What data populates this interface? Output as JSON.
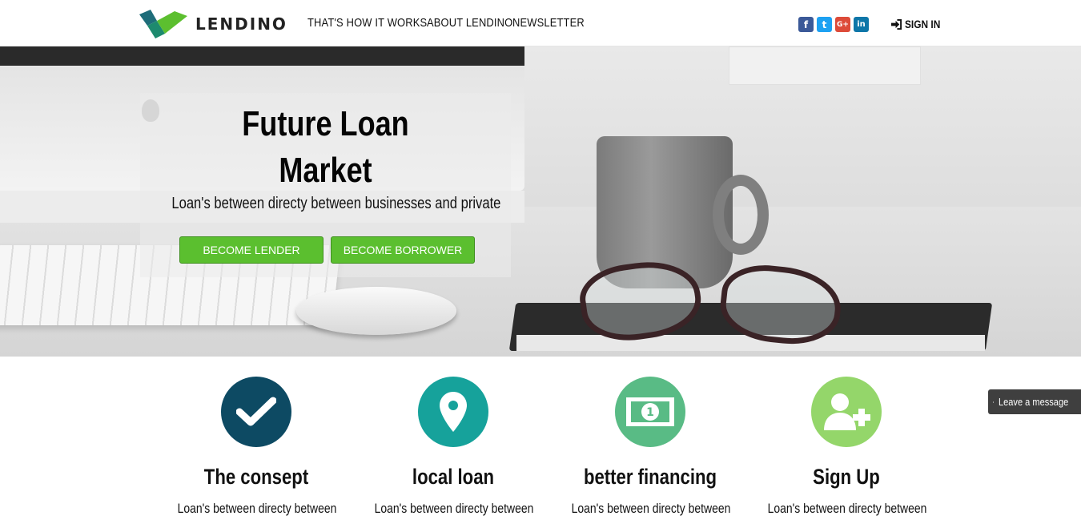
{
  "brand": {
    "name": "LENDINO"
  },
  "nav": {
    "links": [
      "THAT'S HOW IT WORKS",
      "ABOUT LENDINO",
      "NEWSLETTER"
    ],
    "social": [
      {
        "icon": "facebook-icon",
        "glyph": "f",
        "color": "#3b5998"
      },
      {
        "icon": "twitter-icon",
        "glyph": "t",
        "color": "#1da1f2"
      },
      {
        "icon": "google-plus-icon",
        "glyph": "G+",
        "color": "#dd4b39"
      },
      {
        "icon": "linkedin-icon",
        "glyph": "in",
        "color": "#0e76a8"
      }
    ],
    "signin": "SIGN IN"
  },
  "hero": {
    "title_line1": "Future Loan",
    "title_line2": "Market",
    "subtitle": "Loan's between directy between businesses and private",
    "btn_lender": "BECOME LENDER",
    "btn_borrower": "BECOME BORROWER"
  },
  "features": [
    {
      "icon": "checkmark-icon",
      "title": "The consept",
      "text": "Loan's between directy between",
      "color": "#0d4a63"
    },
    {
      "icon": "location-pin-icon",
      "title": "local loan",
      "text": "Loan's between directy between",
      "color": "#16a29b"
    },
    {
      "icon": "banknote-icon",
      "title": "better financing",
      "text": "Loan's between directy between",
      "color": "#59bb85"
    },
    {
      "icon": "add-user-icon",
      "title": "Sign Up",
      "text": "Loan's between directy between",
      "color": "#94d66a"
    }
  ],
  "widget": {
    "leave_message": "Leave a message"
  },
  "colors": {
    "accent_green": "#5bbf2f"
  }
}
